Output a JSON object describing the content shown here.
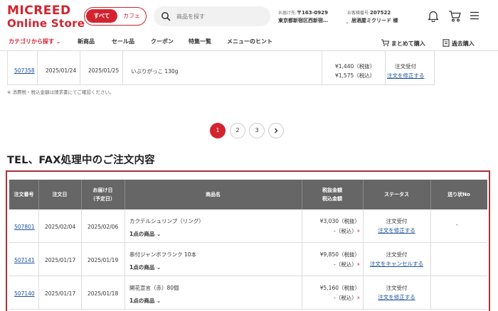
{
  "header": {
    "logo_line1": "MICREED",
    "logo_line2": "Online Store",
    "toggle_all": "すべて",
    "toggle_cafe": "カフェ",
    "search_placeholder": "商品を探す",
    "delivery_label": "お届け先:",
    "delivery_zip": "〒163-0929",
    "delivery_address": "東京都新宿区西新宿…",
    "customer_label": "お客様番号:",
    "customer_number": "207522",
    "customer_name": "居酒屋ミクリード 様"
  },
  "nav": {
    "category": "カテゴリから探す",
    "items": [
      "新商品",
      "セール品",
      "クーポン",
      "特集一覧",
      "メニューのヒント"
    ],
    "bulk_buy": "まとめて購入",
    "past_buy": "過去購入"
  },
  "top_row": {
    "order_no": "507358",
    "order_date": "2025/01/24",
    "delivery_date": "2025/01/25",
    "product": "いぶりがっこ 130g",
    "price_ex": "¥1,440（税抜）",
    "price_in": "¥1,575（税込）",
    "status": "注文受付",
    "action": "注文を修正する"
  },
  "note": "※ 消費税・税込金額は請求書にてご確認ください。",
  "pagination": {
    "pages": [
      "1",
      "2",
      "3"
    ],
    "current": "1"
  },
  "section_title": "TEL、FAX処理中のご注文内容",
  "table": {
    "headers": {
      "order_no": "注文番号",
      "order_date": "注文日",
      "delivery_date_1": "お届け日",
      "delivery_date_2": "（予定日）",
      "product": "商品名",
      "price_1": "税抜金額",
      "price_2": "税込金額",
      "status": "ステータス",
      "tracking": "送り状No"
    },
    "rows": [
      {
        "order_no": "507801",
        "order_date": "2025/02/04",
        "delivery_date": "2025/02/06",
        "product": "カクテルシュリンプ（リング）",
        "count": "1点の商品",
        "price_ex": "¥3,030（税抜）",
        "price_in": "-（税込）",
        "status": "注文受付",
        "action": "注文を修正する",
        "tracking": "-"
      },
      {
        "order_no": "507141",
        "order_date": "2025/01/17",
        "delivery_date": "2025/01/19",
        "product": "串付ジャンボフランク 10本",
        "count": "1点の商品",
        "price_ex": "¥9,850（税抜）",
        "price_in": "-（税込）",
        "status": "注文受付",
        "action": "注文をキャンセルする",
        "tracking": ""
      },
      {
        "order_no": "507140",
        "order_date": "2025/01/17",
        "delivery_date": "2025/01/18",
        "product": "開花宣言（赤）80個",
        "count": "1点の商品",
        "price_ex": "¥5,160（税抜）",
        "price_in": "-（税込）",
        "status": "注文受付",
        "action": "注文を修正する",
        "tracking": ""
      }
    ]
  },
  "colors": {
    "brand": "#d3232f",
    "header_bg": "#666666",
    "link": "#1a4fa0",
    "table_border": "#a8313a"
  },
  "icons": [
    "search-icon",
    "chevron-down-icon",
    "bell-icon",
    "cart-icon",
    "menu-icon",
    "bulk-buy-icon",
    "receipt-icon",
    "chevron-right-icon"
  ]
}
